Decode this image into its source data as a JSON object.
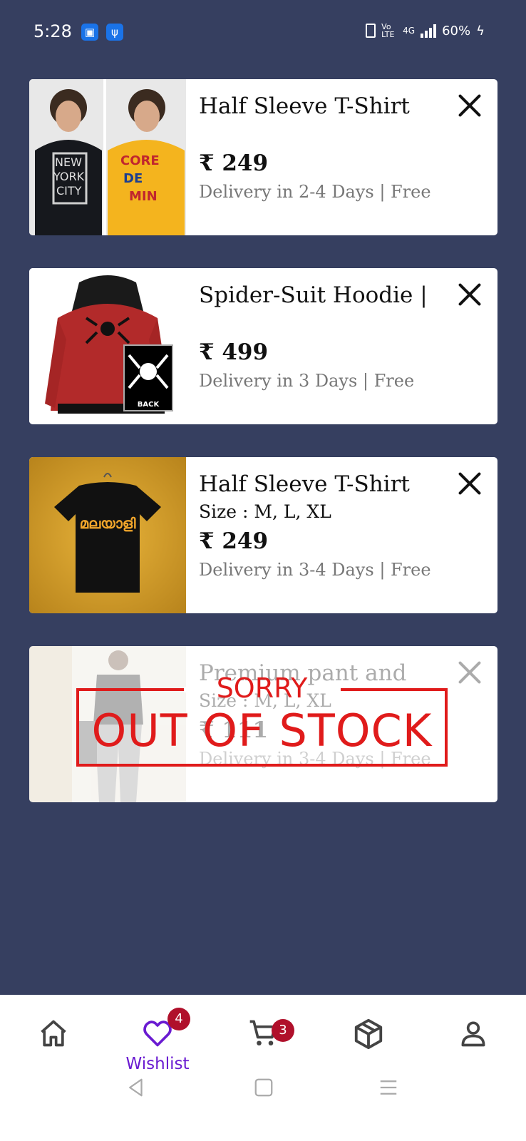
{
  "status_bar": {
    "time": "5:28",
    "volte": "Vo LTE",
    "network": "4G",
    "battery": "60%"
  },
  "wishlist_items": [
    {
      "title": "Half Sleeve T-Shirt",
      "size": "",
      "price": "₹ 249",
      "delivery": "Delivery in 2-4 Days | Free",
      "in_stock": true
    },
    {
      "title": "Spider-Suit Hoodie |",
      "size": "",
      "price": "₹ 499",
      "delivery": "Delivery in 3 Days | Free",
      "in_stock": true
    },
    {
      "title": "Half Sleeve T-Shirt",
      "size": "Size : M, L, XL",
      "price": "₹ 249",
      "delivery": "Delivery in 3-4 Days | Free",
      "in_stock": true
    },
    {
      "title": "Premium pant and",
      "size": "Size : M, L, XL",
      "price": "₹ 111",
      "delivery": "Delivery in 3-4 Days | Free",
      "in_stock": false
    }
  ],
  "out_of_stock": {
    "sorry": "SORRY",
    "main": "OUT OF STOCK"
  },
  "hoodie_badge_text": "BACK",
  "bottom_nav": {
    "wishlist_label": "Wishlist",
    "wishlist_count": "4",
    "cart_count": "3"
  },
  "colors": {
    "background": "#363f60",
    "accent": "#6a1bd1",
    "badge": "#b0102b",
    "stamp": "#e01b1b"
  }
}
